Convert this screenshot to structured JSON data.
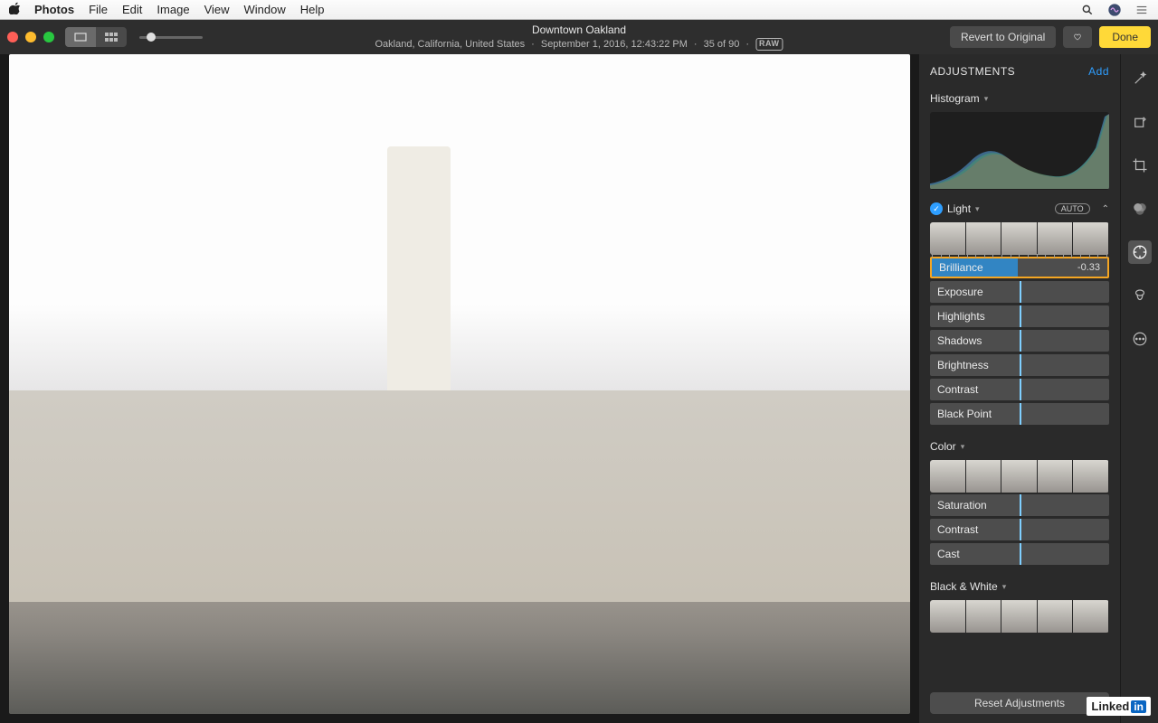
{
  "menubar": {
    "app": "Photos",
    "items": [
      "File",
      "Edit",
      "Image",
      "View",
      "Window",
      "Help"
    ]
  },
  "toolbar": {
    "title": "Downtown Oakland",
    "location": "Oakland, California, United States",
    "date": "September 1, 2016, 12:43:22 PM",
    "counter": "35 of 90",
    "raw_badge": "RAW",
    "revert_label": "Revert to Original",
    "done_label": "Done"
  },
  "adjustments": {
    "title": "ADJUSTMENTS",
    "add_label": "Add",
    "histogram_label": "Histogram",
    "light": {
      "label": "Light",
      "auto_label": "AUTO",
      "sliders": {
        "brilliance": {
          "label": "Brilliance",
          "value": "-0.33"
        },
        "exposure": {
          "label": "Exposure"
        },
        "highlights": {
          "label": "Highlights"
        },
        "shadows": {
          "label": "Shadows"
        },
        "brightness": {
          "label": "Brightness"
        },
        "contrast": {
          "label": "Contrast"
        },
        "black_point": {
          "label": "Black Point"
        }
      }
    },
    "color": {
      "label": "Color",
      "sliders": {
        "saturation": {
          "label": "Saturation"
        },
        "contrast": {
          "label": "Contrast"
        },
        "cast": {
          "label": "Cast"
        }
      }
    },
    "bw": {
      "label": "Black & White"
    },
    "reset_label": "Reset Adjustments"
  },
  "footer": {
    "brand": "Linked",
    "brand_box": "in"
  }
}
